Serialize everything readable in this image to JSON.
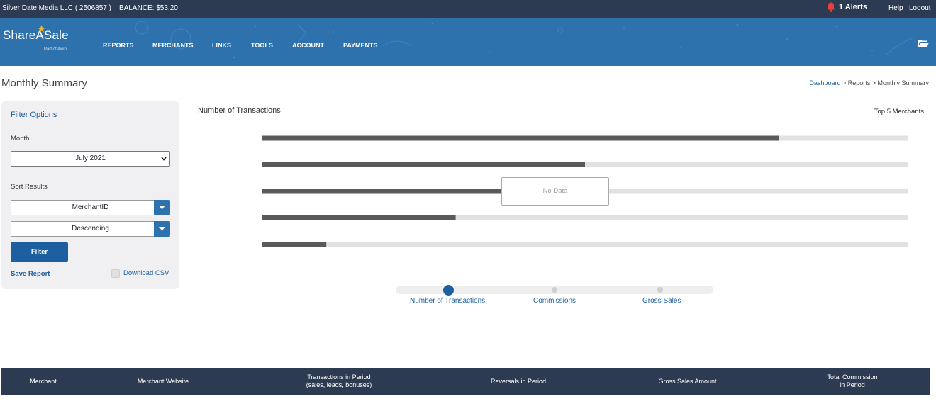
{
  "account": {
    "name": "Silver Date Media LLC ( 2506857 )",
    "balance": "BALANCE: $53.20",
    "alerts": "1 Alerts",
    "help": "Help",
    "logout": "Logout"
  },
  "brand": {
    "name": "ShareASale",
    "tagline": "Part of Awin",
    "color": "#2e72ad"
  },
  "nav": {
    "items": [
      "REPORTS",
      "MERCHANTS",
      "LINKS",
      "TOOLS",
      "ACCOUNT",
      "PAYMENTS"
    ]
  },
  "page": {
    "title": "Monthly Summary",
    "breadcrumb": {
      "home": "Dashboard",
      "rest": " > Reports > Monthly Summary"
    }
  },
  "filter": {
    "title": "Filter Options",
    "month_label": "Month",
    "month_value": "July 2021",
    "sort_label": "Sort Results",
    "sort_by": "MerchantID",
    "sort_order": "Descending",
    "filter_button": "Filter",
    "save_report": "Save Report",
    "download_csv": "Download CSV"
  },
  "chart_data": {
    "type": "bar",
    "title": "Number of Transactions",
    "legend_title": "Top 5 Merchants",
    "orientation": "horizontal",
    "categories": [
      "",
      "",
      "",
      "",
      ""
    ],
    "values": [
      0.8,
      0.5,
      0.37,
      0.3,
      0.1
    ],
    "xlim": [
      0,
      1
    ],
    "grid": false,
    "no_data_message": "No Data",
    "track_color": "#e2e2e2",
    "bar_color": "#5a5a5a"
  },
  "metric_tabs": {
    "items": [
      "Number of Transactions",
      "Commissions",
      "Gross Sales"
    ],
    "active_index": 0
  },
  "table": {
    "columns": [
      "Merchant",
      "Merchant Website",
      "Transactions in Period\n(sales, leads, bonuses)",
      "Reversals in Period",
      "Gross Sales Amount",
      "Total Commission\nin Period"
    ]
  }
}
